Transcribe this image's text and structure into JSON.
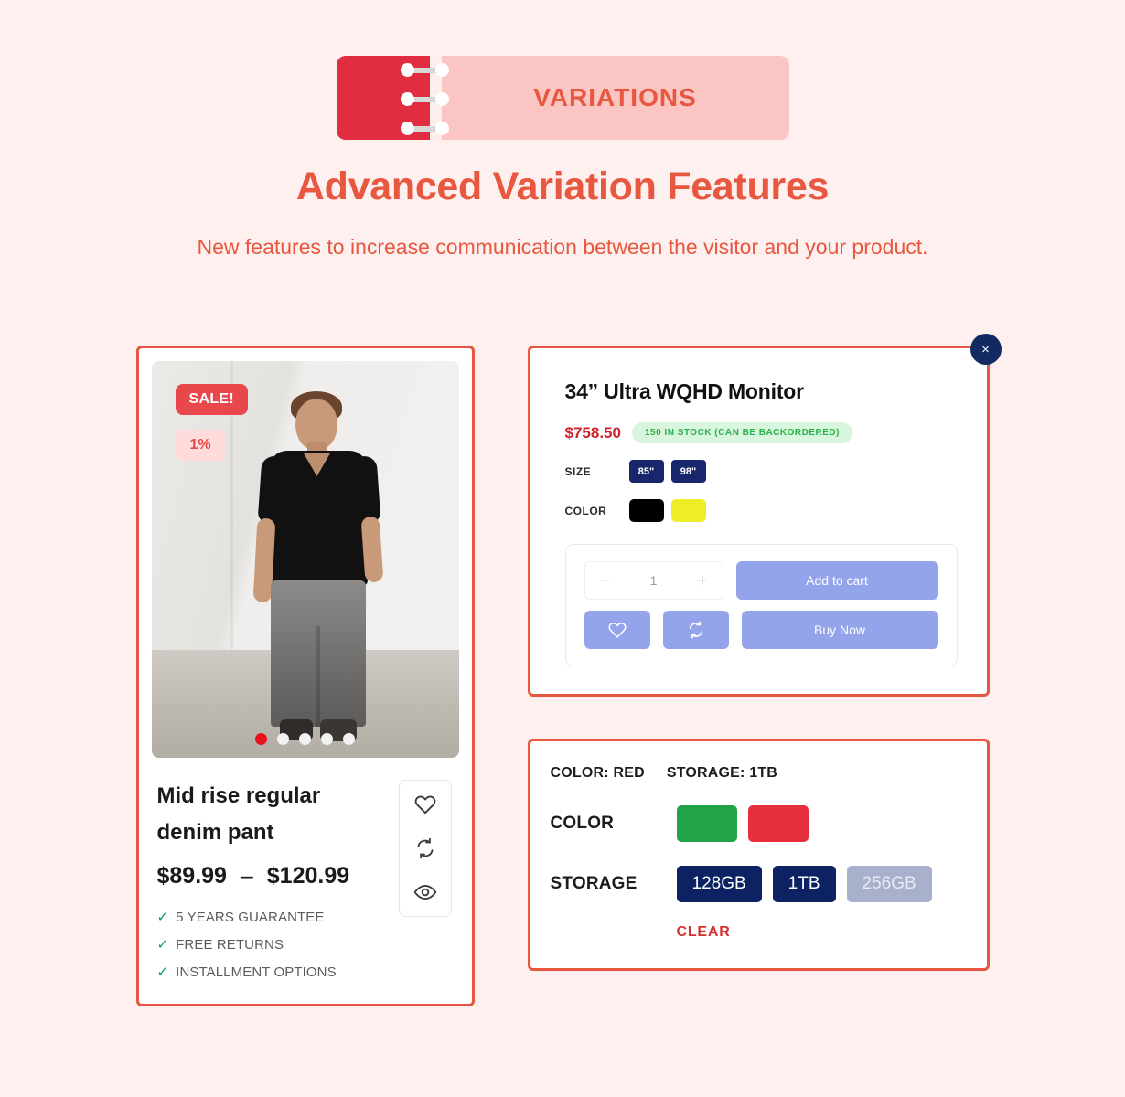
{
  "header": {
    "ribbon_label": "VARIATIONS",
    "title": "Advanced Variation Features",
    "subtitle": "New features to increase communication between the visitor and your product."
  },
  "theme": {
    "page_bg": "#fdf0ef",
    "accent": "#e8573f",
    "ribbon_spine": "#e02d40",
    "ribbon_body": "#fbc5c3",
    "navy": "#18276b",
    "periwinkle": "#93a4ea"
  },
  "product_card": {
    "badges": {
      "sale": "SALE!",
      "discount": "1%"
    },
    "carousel": {
      "total_dots": 5,
      "active_index": 0,
      "active_color": "#e8121c"
    },
    "title": "Mid rise regular denim pant",
    "price_min": "$89.99",
    "price_dash": "–",
    "price_max": "$120.99",
    "features": [
      "5 YEARS GUARANTEE",
      "FREE RETURNS",
      "INSTALLMENT OPTIONS"
    ],
    "rail_icons": [
      "heart-icon",
      "compare-icon",
      "eye-icon"
    ]
  },
  "monitor_card": {
    "close_label": "×",
    "title": "34” Ultra WQHD Monitor",
    "price": "$758.50",
    "stock_badge": "150 IN STOCK (CAN BE BACKORDERED)",
    "attributes": [
      {
        "label": "SIZE",
        "type": "text",
        "options": [
          "85\"",
          "98\""
        ]
      },
      {
        "label": "COLOR",
        "type": "color",
        "options": [
          "#000000",
          "#eded28"
        ]
      }
    ],
    "quantity": {
      "minus": "−",
      "value": "1",
      "plus": "+"
    },
    "add_to_cart_label": "Add to cart",
    "buy_now_label": "Buy Now",
    "wishlist_icon": "heart-icon",
    "compare_icon": "compare-icon"
  },
  "variation_card": {
    "summary": [
      "COLOR: RED",
      "STORAGE: 1TB"
    ],
    "color": {
      "label": "COLOR",
      "options": [
        {
          "name": "green",
          "hex": "#22a34a"
        },
        {
          "name": "red",
          "hex": "#e62e3d"
        }
      ]
    },
    "storage": {
      "label": "STORAGE",
      "options": [
        {
          "label": "128GB",
          "state": "available"
        },
        {
          "label": "1TB",
          "state": "available"
        },
        {
          "label": "256GB",
          "state": "muted"
        }
      ]
    },
    "clear_label": "CLEAR"
  }
}
